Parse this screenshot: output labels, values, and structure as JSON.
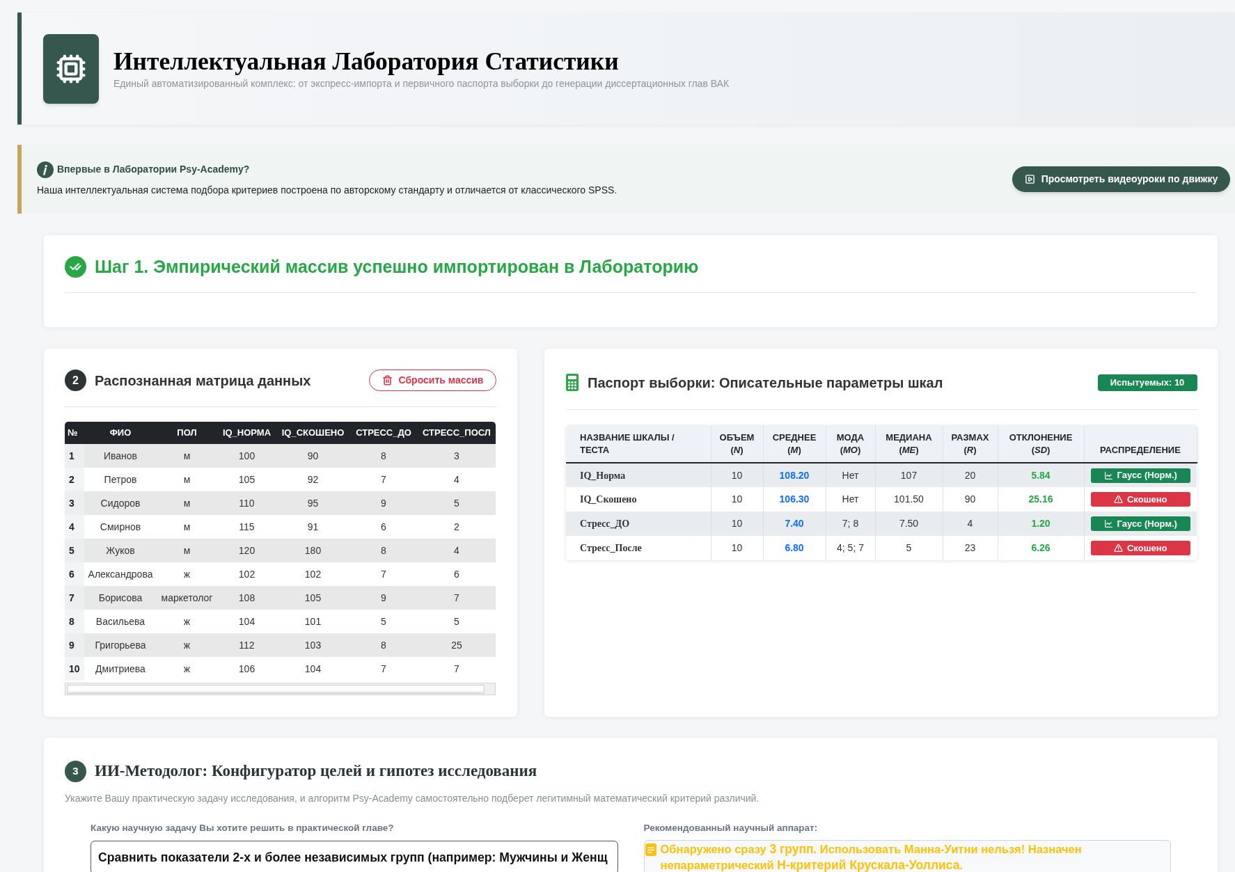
{
  "header": {
    "title": "Интеллектуальная Лаборатория Статистики",
    "subtitle": "Единый автоматизированный комплекс: от экспресс-импорта и первичного паспорта выборки до генерации диссертационных глав ВАК"
  },
  "info_banner": {
    "title": "Впервые в Лаборатории Psy-Academy?",
    "text": "Наша интеллектуальная система подбора критериев построена по авторскому стандарту и отличается от классического SPSS.",
    "button": "Просмотреть видеоуроки по движку"
  },
  "step1": {
    "title": "Шаг 1. Эмпирический массив успешно импортирован в Лабораторию"
  },
  "data_matrix": {
    "number": "2",
    "title": "Распознанная матрица данных",
    "reset_button": "Сбросить массив",
    "columns": [
      "№",
      "ФИО",
      "ПОЛ",
      "IQ_НОРМА",
      "IQ_СКОШЕНО",
      "СТРЕСС_ДО",
      "СТРЕСС_ПОСЛ"
    ],
    "rows": [
      [
        "1",
        "Иванов",
        "м",
        "100",
        "90",
        "8",
        "3"
      ],
      [
        "2",
        "Петров",
        "м",
        "105",
        "92",
        "7",
        "4"
      ],
      [
        "3",
        "Сидоров",
        "м",
        "110",
        "95",
        "9",
        "5"
      ],
      [
        "4",
        "Смирнов",
        "м",
        "115",
        "91",
        "6",
        "2"
      ],
      [
        "5",
        "Жуков",
        "м",
        "120",
        "180",
        "8",
        "4"
      ],
      [
        "6",
        "Александрова",
        "ж",
        "102",
        "102",
        "7",
        "6"
      ],
      [
        "7",
        "Борисова",
        "маркетолог",
        "108",
        "105",
        "9",
        "7"
      ],
      [
        "8",
        "Васильева",
        "ж",
        "104",
        "101",
        "5",
        "5"
      ],
      [
        "9",
        "Григорьева",
        "ж",
        "112",
        "103",
        "8",
        "25"
      ],
      [
        "10",
        "Дмитриева",
        "ж",
        "106",
        "104",
        "7",
        "7"
      ]
    ]
  },
  "sample_passport": {
    "title": "Паспорт выборки: Описательные параметры шкал",
    "badge": "Испытуемых: 10",
    "columns": [
      "НАЗВАНИЕ ШКАЛЫ / ТЕСТА",
      "ОБЪЕМ (*N*)",
      "СРЕДНЕЕ (*M*)",
      "МОДА (*MO*)",
      "МЕДИАНА (*ME*)",
      "РАЗМАХ (*R*)",
      "ОТКЛОНЕНИЕ (*SD*)",
      "РАСПРЕДЕЛЕНИЕ"
    ],
    "rows": [
      {
        "name": "IQ_Норма",
        "values": [
          "10",
          "108.20",
          "Нет",
          "107",
          "20",
          "5.84"
        ],
        "distribution": {
          "kind": "normal",
          "label": "Гаусс (Норм.)"
        }
      },
      {
        "name": "IQ_Скошено",
        "values": [
          "10",
          "106.30",
          "Нет",
          "101.50",
          "90",
          "25.16"
        ],
        "distribution": {
          "kind": "skewed",
          "label": "Скошено"
        }
      },
      {
        "name": "Стресс_ДО",
        "values": [
          "10",
          "7.40",
          "7; 8",
          "7.50",
          "4",
          "1.20"
        ],
        "distribution": {
          "kind": "normal",
          "label": "Гаусс (Норм.)"
        }
      },
      {
        "name": "Стресс_После",
        "values": [
          "10",
          "6.80",
          "4; 5; 7",
          "5",
          "23",
          "6.26"
        ],
        "distribution": {
          "kind": "skewed",
          "label": "Скошено"
        }
      }
    ]
  },
  "methodologist": {
    "number": "3",
    "title": "ИИ-Методолог: Конфигуратор целей и гипотез исследования",
    "subtitle": "Укажите Вашу практическую задачу исследования, и алгоритм Psy-Academy самостоятельно подберет легитимный математический критерий различий.",
    "task_label": "Какую научную задачу Вы хотите решить в практической главе?",
    "task_value": "Сравнить показатели 2-х и более независимых групп (например: Мужчины и Женщ",
    "recommendation_label": "Рекомендованный научный аппарат:",
    "recommendation": "Обнаружено сразу **3 групп**. Использовать Манна-Уитни нельзя! Назначен непараметрический **Н-критерий Крускала-Уоллиса**."
  }
}
